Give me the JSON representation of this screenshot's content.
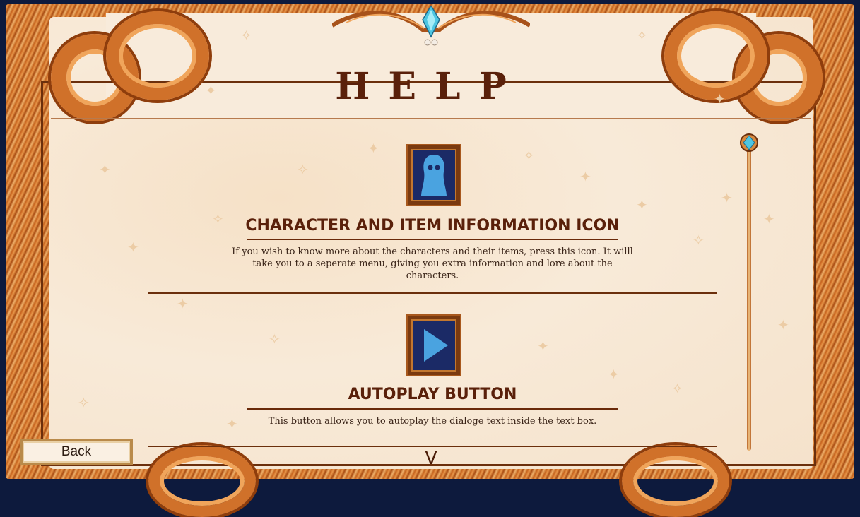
{
  "screen": {
    "title": "HELP"
  },
  "sections": [
    {
      "icon": "ghost-icon",
      "title": "CHARACTER AND ITEM INFORMATION ICON",
      "description": "If you wish to know more about the characters and their items, press this icon. It willl take you to a seperate menu, giving you extra information and lore about the characters."
    },
    {
      "icon": "play-icon",
      "title": "AUTOPLAY BUTTON",
      "description": "This button allows you to autoplay the dialoge text inside the text box."
    }
  ],
  "controls": {
    "back_label": "Back",
    "scroll_down_label": "V"
  },
  "colors": {
    "frame": "#d0712a",
    "parchment": "#f8ebdb",
    "title_text": "#5a200a",
    "icon_bg": "#1b2a66",
    "icon_fg": "#4aa3e0",
    "background": "#0d1a3d"
  }
}
